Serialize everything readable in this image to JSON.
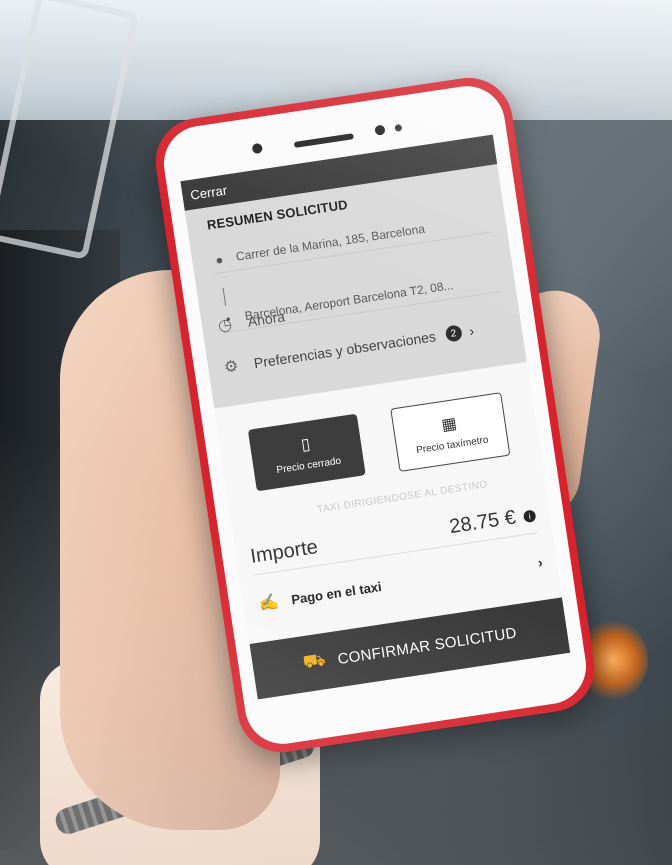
{
  "app": {
    "close_label": "Cerrar",
    "summary_title": "RESUMEN SOLICITUD",
    "origin": "Carrer de la Marina, 185, Barcelona",
    "destination": "Barcelona, Aeroport Barcelona T2, 08...",
    "when_label": "Ahora",
    "preferences_label": "Preferencias y observaciones",
    "preferences_count": "2",
    "price_options": [
      {
        "label": "Precio cerrado",
        "icon": "phone-price-icon",
        "selected": true
      },
      {
        "label": "Precio taxímetro",
        "icon": "taximeter-icon",
        "selected": false
      }
    ],
    "ghost_text": "TAXI DIRIGIENDOSE AL DESTINO",
    "amount_label": "Importe",
    "amount_value": "28.75 €",
    "payment_label": "Pago en el taxi",
    "confirm_label": "CONFIRMAR SOLICITUD"
  },
  "colors": {
    "phone_case": "#d6232d",
    "dark_bar": "#3a3a3a",
    "taxi_icon": "#f2b01e"
  }
}
